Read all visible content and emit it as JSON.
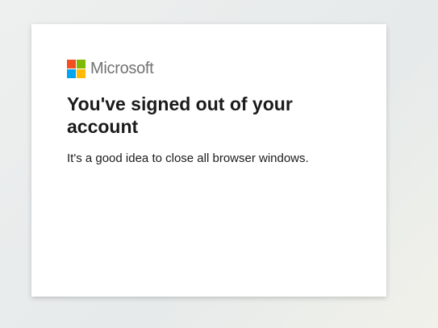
{
  "brand": {
    "name": "Microsoft",
    "logo_icon": "microsoft-logo-icon",
    "colors": {
      "red": "#f25022",
      "green": "#7fba00",
      "blue": "#00a4ef",
      "yellow": "#ffb900"
    }
  },
  "signout": {
    "title": "You've signed out of your account",
    "message": "It's a good idea to close all browser windows."
  }
}
